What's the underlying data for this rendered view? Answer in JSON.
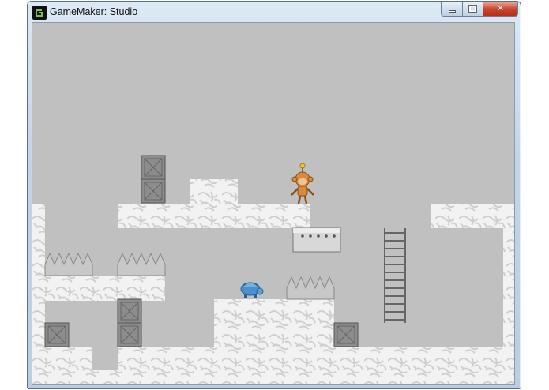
{
  "window": {
    "title": "GameMaker: Studio",
    "icon": "gamemaker-logo-icon",
    "controls": {
      "minimize_icon": "minimize-icon",
      "maximize_icon": "maximize-icon",
      "close_icon": "close-icon",
      "close_glyph": "✕"
    }
  },
  "game": {
    "background_color": "#c0c0c0",
    "tile_color": "#f2f2f2",
    "tile_pattern_color": "#d2d2d2",
    "crate_color": "#8c8c8c",
    "player_sprite": "robot-monkey-player-icon",
    "enemy_sprite": "blue-turtle-enemy-icon",
    "props": [
      "crate-icon",
      "spikes-icon",
      "ladder-icon",
      "moving-platform-icon"
    ]
  }
}
